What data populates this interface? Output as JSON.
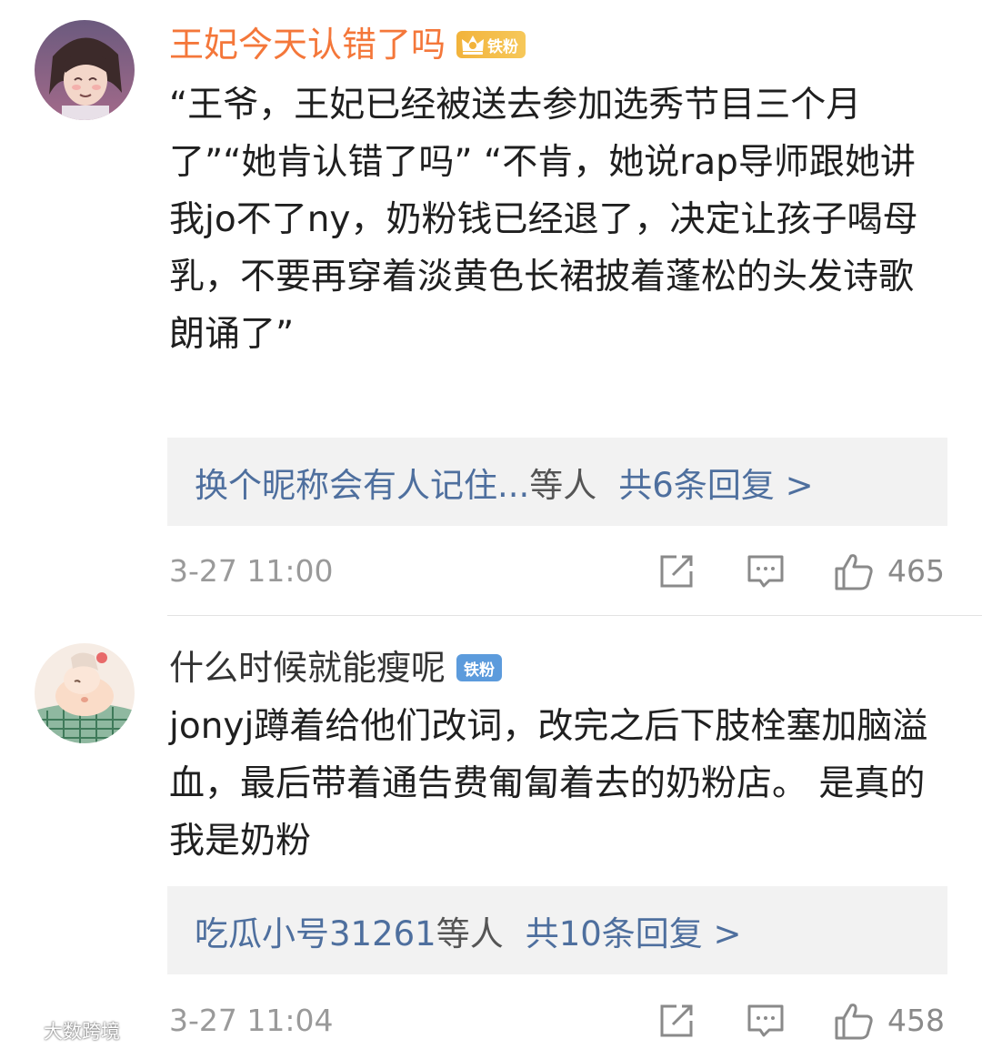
{
  "comments": [
    {
      "username": "王妃今天认错了吗",
      "fan_badge": "铁粉",
      "content": "“王爷，王妃已经被送去参加选秀节目三个月了”“她肯认错了吗”                         “不肯，她说rap导师跟她讲我jo不了ny，奶粉钱已经退了，决定让孩子喝母乳，不要再穿着淡黄色长裙披着蓬松的头发诗歌朗诵了”",
      "reply_names": "换个昵称会有人记住...",
      "reply_suffix": "等人",
      "reply_count": "共6条回复 >",
      "timestamp": "3-27 11:00",
      "likes": "465"
    },
    {
      "username": "什么时候就能瘦呢",
      "fan_badge": "铁粉",
      "content": "jonyj蹲着给他们改词，改完之后下肢栓塞加脑溢血，最后带着通告费匍匐着去的奶粉店。 是真的 我是奶粉",
      "reply_names": "吃瓜小号31261",
      "reply_suffix": "等人",
      "reply_count": "共10条回复 >",
      "timestamp": "3-27 11:04",
      "likes": "458"
    }
  ],
  "watermark": "大数跨境",
  "colors": {
    "vip_name": "#f4773a",
    "link": "#4e6f9e",
    "reply_bg": "#f2f2f2",
    "meta": "#9a9a9a",
    "gold_badge": "#f2b33b",
    "blue_badge": "#5c9bdc"
  },
  "icons": [
    "crown-icon",
    "share-icon",
    "comment-icon",
    "like-icon",
    "weibo-logo-icon"
  ]
}
